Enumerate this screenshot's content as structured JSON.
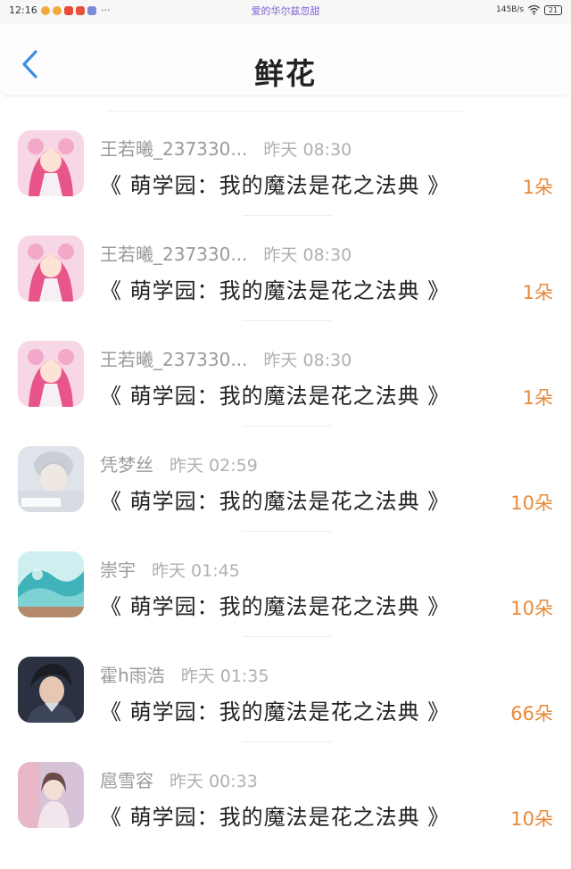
{
  "status_bar": {
    "time": "12:16",
    "notification_text": "爱的华尔兹忽甜",
    "network_speed": "145B/s",
    "battery": "21",
    "more_label": "···"
  },
  "header": {
    "title": "鲜花"
  },
  "items": [
    {
      "name": "王若曦_237330...",
      "time": "昨天 08:30",
      "book": "《 萌学园：我的魔法是花之法典 》",
      "count": "1朵"
    },
    {
      "name": "王若曦_237330...",
      "time": "昨天 08:30",
      "book": "《 萌学园：我的魔法是花之法典 》",
      "count": "1朵"
    },
    {
      "name": "王若曦_237330...",
      "time": "昨天 08:30",
      "book": "《 萌学园：我的魔法是花之法典 》",
      "count": "1朵"
    },
    {
      "name": "凭梦丝",
      "time": "昨天 02:59",
      "book": "《 萌学园：我的魔法是花之法典 》",
      "count": "10朵"
    },
    {
      "name": "崇宇",
      "time": "昨天 01:45",
      "book": "《 萌学园：我的魔法是花之法典 》",
      "count": "10朵"
    },
    {
      "name": "霍h雨浩",
      "time": "昨天 01:35",
      "book": "《 萌学园：我的魔法是花之法典 》",
      "count": "66朵"
    },
    {
      "name": "扈雪容",
      "time": "昨天 00:33",
      "book": "《 萌学园：我的魔法是花之法典 》",
      "count": "10朵"
    }
  ],
  "colors": {
    "count": "#e8893a",
    "back_arrow": "#3a8ee6",
    "notification": "#7b5fd6"
  },
  "icons": {
    "back": "chevron-left-icon",
    "wifi": "wifi-icon",
    "battery": "battery-icon"
  }
}
